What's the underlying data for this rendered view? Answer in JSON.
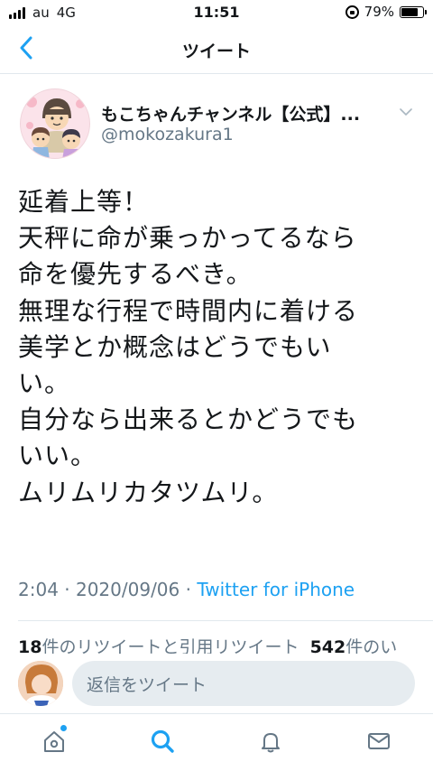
{
  "status_bar": {
    "carrier": "au",
    "network": "4G",
    "time": "11:51",
    "battery": "79%",
    "battery_level": 0.79
  },
  "nav": {
    "title": "ツイート"
  },
  "tweet": {
    "author_name": "もこちゃんチャンネル【公式】...",
    "author_handle": "@mokozakura1",
    "text_lines": [
      "延着上等！",
      "天秤に命が乗っかってるなら",
      "命を優先するべき。",
      "無理な行程で時間内に着ける",
      "美学とか概念はどうでもい",
      "い。",
      "自分なら出来るとかどうでも",
      "いい。",
      "ムリムリカタツムリ。"
    ],
    "meta_time": "2:04 · 2020/09/06 · ",
    "meta_source": "Twitter for iPhone"
  },
  "stats": {
    "retweet_count": "18",
    "retweet_label": "件のリツイートと引用リツイート",
    "like_count": "542",
    "like_label": "件のい"
  },
  "reply": {
    "placeholder": "返信をツイート"
  },
  "colors": {
    "accent": "#1da1f2",
    "secondary_text": "#657786",
    "divider": "#e1e8ed"
  }
}
